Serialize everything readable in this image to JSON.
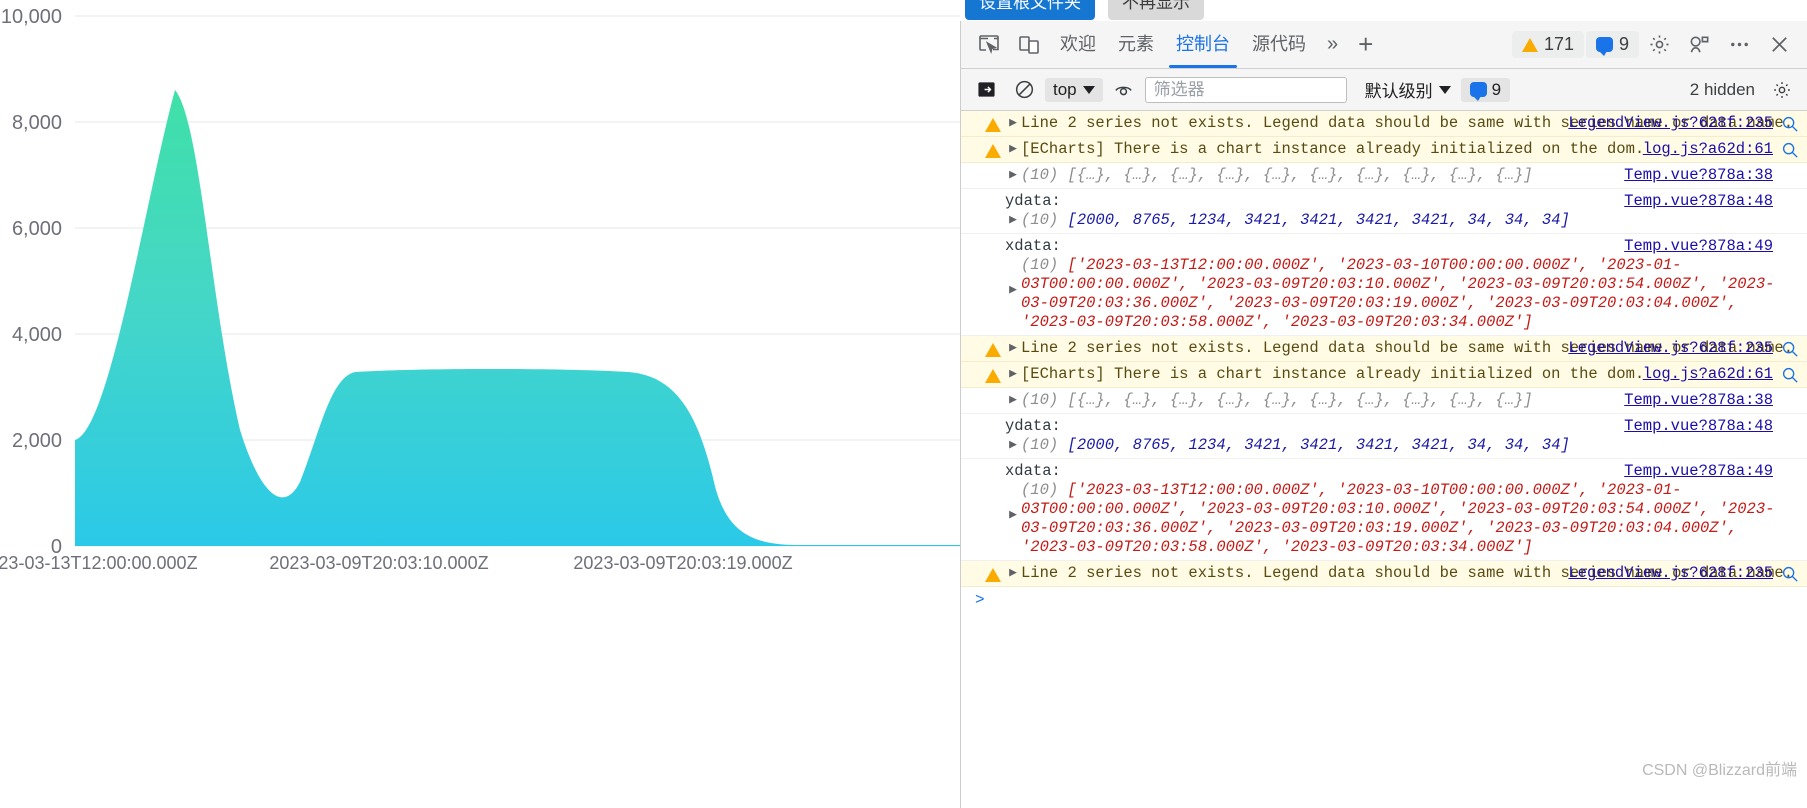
{
  "page_buttons": [
    {
      "label": "设置根文件夹",
      "style": "primary"
    },
    {
      "label": "不再显示",
      "style": "plain"
    }
  ],
  "devtools": {
    "tabs": [
      {
        "label": "欢迎",
        "active": false
      },
      {
        "label": "元素",
        "active": false
      },
      {
        "label": "控制台",
        "active": true
      },
      {
        "label": "源代码",
        "active": false
      }
    ],
    "more_tabs_icon": "chevron-double-right-icon",
    "add_tab_icon": "plus-icon",
    "inspect_icon": "inspect-element-icon",
    "device_icon": "device-toolbar-icon",
    "settings_icon": "gear-icon",
    "issues_icon": "issues-icon",
    "more_icon": "more-options-icon",
    "close_icon": "close-icon",
    "warning_count": "171",
    "message_count": "9",
    "filter_bar": {
      "sidebar_icon": "console-sidebar-icon",
      "clear_icon": "clear-console-icon",
      "context": "top",
      "eye_icon": "live-expression-icon",
      "filter_placeholder": "筛选器",
      "level": "默认级别",
      "level_badge": "9",
      "hidden_note": "2 hidden",
      "settings_icon": "gear-icon"
    }
  },
  "console": {
    "magnifier_icon": "magnifier-icon",
    "prompt": ">",
    "messages": [
      {
        "type": "warning",
        "expandable": true,
        "text": "Line 2 series not exists. Legend data should be same with series name or data name.",
        "source": "LegendView.js?628f:235",
        "has_magnifier": true
      },
      {
        "type": "warning",
        "expandable": true,
        "text": "[ECharts] There is a chart instance already initialized on the dom.",
        "source": "log.js?a62d:61",
        "has_magnifier": true
      },
      {
        "type": "log",
        "expandable": true,
        "kind": "array_of_objects",
        "count": "(10)",
        "text": "[{…}, {…}, {…}, {…}, {…}, {…}, {…}, {…}, {…}, {…}]",
        "source": "Temp.vue?878a:38",
        "has_magnifier": false
      },
      {
        "type": "log",
        "expandable": true,
        "kind": "labeled_numeric_array",
        "label": "ydata:",
        "count": "(10)",
        "text": "[2000, 8765, 1234, 3421, 3421, 3421, 3421, 34, 34, 34]",
        "source": "Temp.vue?878a:48",
        "has_magnifier": false
      },
      {
        "type": "log",
        "expandable": true,
        "kind": "labeled_string_array",
        "label": "xdata:",
        "count": "(10)",
        "text": "['2023-03-13T12:00:00.000Z', '2023-03-10T00:00:00.000Z', '2023-01-03T00:00:00.000Z', '2023-03-09T20:03:10.000Z', '2023-03-09T20:03:54.000Z', '2023-03-09T20:03:36.000Z', '2023-03-09T20:03:19.000Z', '2023-03-09T20:03:04.000Z', '2023-03-09T20:03:58.000Z', '2023-03-09T20:03:34.000Z']",
        "source": "Temp.vue?878a:49",
        "has_magnifier": false
      },
      {
        "type": "warning",
        "expandable": true,
        "text": "Line 2 series not exists. Legend data should be same with series name or data name.",
        "source": "LegendView.js?628f:235",
        "has_magnifier": true
      },
      {
        "type": "warning",
        "expandable": true,
        "text": "[ECharts] There is a chart instance already initialized on the dom.",
        "source": "log.js?a62d:61",
        "has_magnifier": true
      },
      {
        "type": "log",
        "expandable": true,
        "kind": "array_of_objects",
        "count": "(10)",
        "text": "[{…}, {…}, {…}, {…}, {…}, {…}, {…}, {…}, {…}, {…}]",
        "source": "Temp.vue?878a:38",
        "has_magnifier": false
      },
      {
        "type": "log",
        "expandable": true,
        "kind": "labeled_numeric_array",
        "label": "ydata:",
        "count": "(10)",
        "text": "[2000, 8765, 1234, 3421, 3421, 3421, 3421, 34, 34, 34]",
        "source": "Temp.vue?878a:48",
        "has_magnifier": false
      },
      {
        "type": "log",
        "expandable": true,
        "kind": "labeled_string_array",
        "label": "xdata:",
        "count": "(10)",
        "text": "['2023-03-13T12:00:00.000Z', '2023-03-10T00:00:00.000Z', '2023-01-03T00:00:00.000Z', '2023-03-09T20:03:10.000Z', '2023-03-09T20:03:54.000Z', '2023-03-09T20:03:36.000Z', '2023-03-09T20:03:19.000Z', '2023-03-09T20:03:04.000Z', '2023-03-09T20:03:58.000Z', '2023-03-09T20:03:34.000Z']",
        "source": "Temp.vue?878a:49",
        "has_magnifier": false
      },
      {
        "type": "warning",
        "expandable": true,
        "text": "Line 2 series not exists. Legend data should be same with series name or data name.",
        "source": "LegendView.js?628f:235",
        "has_magnifier": true
      }
    ]
  },
  "watermark": "CSDN @Blizzard前端",
  "chart_data": {
    "type": "area",
    "title": "",
    "xlabel": "",
    "ylabel": "",
    "ylim": [
      0,
      10000
    ],
    "grid": true,
    "legend": "none",
    "smooth": true,
    "gradient": {
      "top": "#3fe0a8",
      "bottom": "#2bc9e8"
    },
    "y_ticks": [
      "0",
      "2,000",
      "4,000",
      "6,000",
      "8,000",
      "10,000"
    ],
    "y_tick_values": [
      0,
      2000,
      4000,
      6000,
      8000,
      10000
    ],
    "x_tick_labels": [
      "23-03-13T12:00:00.000Z",
      "2023-03-09T20:03:10.000Z",
      "2023-03-09T20:03:19.000Z"
    ],
    "categories": [
      "2023-03-13T12:00:00.000Z",
      "2023-03-10T00:00:00.000Z",
      "2023-01-03T00:00:00.000Z",
      "2023-03-09T20:03:10.000Z",
      "2023-03-09T20:03:54.000Z",
      "2023-03-09T20:03:36.000Z",
      "2023-03-09T20:03:19.000Z",
      "2023-03-09T20:03:04.000Z",
      "2023-03-09T20:03:58.000Z",
      "2023-03-09T20:03:34.000Z"
    ],
    "values": [
      2000,
      8765,
      1234,
      3421,
      3421,
      3421,
      3421,
      34,
      34,
      34
    ]
  }
}
